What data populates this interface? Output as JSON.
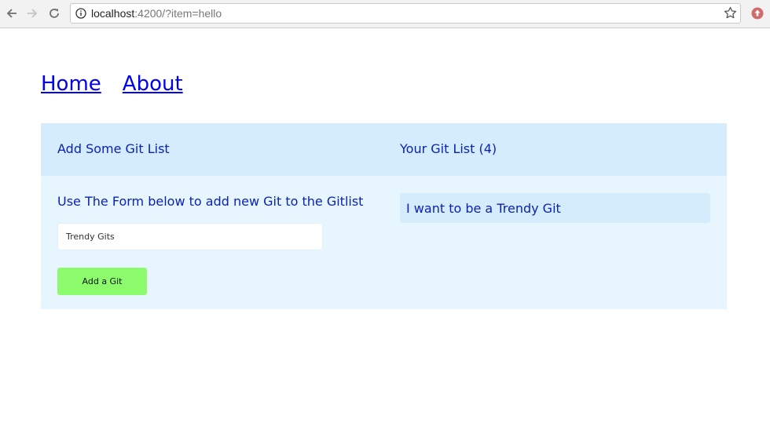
{
  "browser": {
    "url_host": "localhost",
    "url_rest": ":4200/?item=hello"
  },
  "nav": {
    "home": "Home",
    "about": "About"
  },
  "panel": {
    "add_heading": "Add Some Git List",
    "list_heading": "Your Git List (4)",
    "instructions": "Use The Form below to add new Git to the Gitlist",
    "input_value": "Trendy Gits",
    "button_label": "Add a Git",
    "items": [
      "I want to be a Trendy Git"
    ]
  },
  "colors": {
    "heading": "#0a22b6",
    "panel_bg": "#e7f5fe",
    "header_bg": "#d5ecfc",
    "button_bg": "#8cfb6c",
    "link": "#0000ee"
  },
  "icons": [
    "back-icon",
    "forward-icon",
    "reload-icon",
    "info-icon",
    "bookmark-star-icon",
    "extension-icon"
  ]
}
